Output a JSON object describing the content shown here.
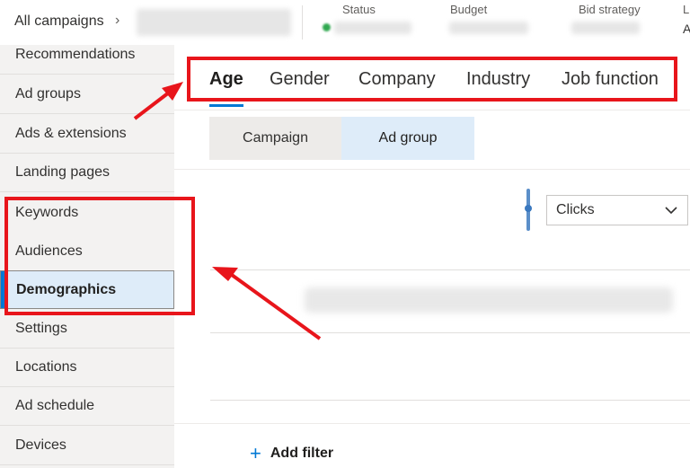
{
  "header": {
    "breadcrumb": "All campaigns",
    "chevron": "›",
    "labels": {
      "status": "Status",
      "budget": "Budget",
      "bid_strategy": "Bid strategy",
      "truncated": "L"
    },
    "truncated_value": "A"
  },
  "sidebar": {
    "items": [
      {
        "label": "Recommendations"
      },
      {
        "label": "Ad groups"
      },
      {
        "label": "Ads & extensions"
      },
      {
        "label": "Landing pages"
      },
      {
        "label": "Keywords"
      },
      {
        "label": "Audiences"
      },
      {
        "label": "Demographics",
        "active": true
      },
      {
        "label": "Settings"
      },
      {
        "label": "Locations"
      },
      {
        "label": "Ad schedule"
      },
      {
        "label": "Devices"
      }
    ]
  },
  "tabs": [
    {
      "label": "Age",
      "active": true
    },
    {
      "label": "Gender"
    },
    {
      "label": "Company"
    },
    {
      "label": "Industry"
    },
    {
      "label": "Job function"
    }
  ],
  "segments": {
    "campaign": "Campaign",
    "ad_group": "Ad group",
    "selected": "Ad group"
  },
  "metric_dropdown": {
    "value": "Clicks",
    "icon": "chevron-down-icon"
  },
  "add_filter": {
    "label": "Add filter",
    "icon": "plus-icon"
  },
  "colors": {
    "accent": "#0078d4",
    "annotation": "#e8151b",
    "active_bg": "#deecf9"
  }
}
